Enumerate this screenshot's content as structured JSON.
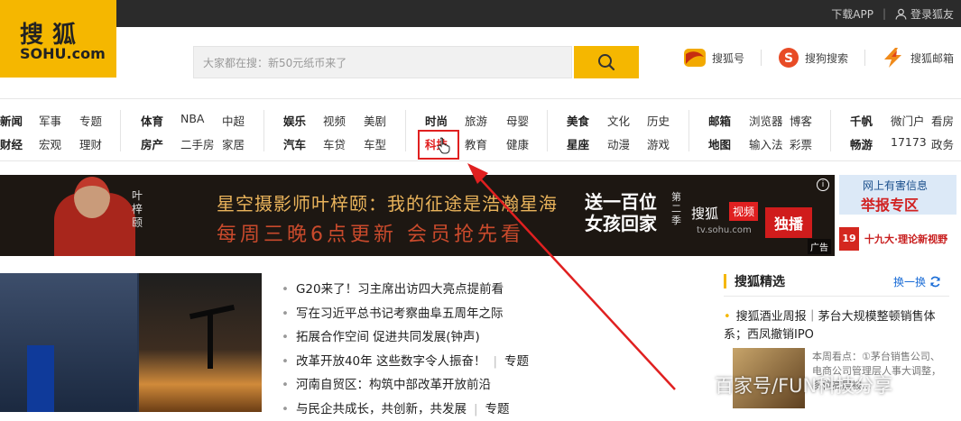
{
  "topbar": {
    "download": "下载APP",
    "separator": "|",
    "login": "登录狐友"
  },
  "logo": {
    "cn": "搜狐",
    "en": "SOHU.com"
  },
  "search": {
    "placeholder": "大家都在搜：新50元纸币来了"
  },
  "brands": [
    {
      "label": "搜狐号",
      "color": "#e23b18"
    },
    {
      "label": "搜狗搜索",
      "color": "#e84b26"
    },
    {
      "label": "搜狐邮箱",
      "color": "#f08a1a"
    }
  ],
  "nav": {
    "g1": [
      "新闻",
      "军事",
      "专题",
      "财经",
      "宏观",
      "理财"
    ],
    "g2": [
      "体育",
      "NBA",
      "中超",
      "房产",
      "二手房",
      "家居"
    ],
    "g3": [
      "娱乐",
      "视频",
      "美剧",
      "汽车",
      "车贷",
      "车型"
    ],
    "g4": [
      "时尚",
      "旅游",
      "母婴",
      "科技",
      "教育",
      "健康"
    ],
    "g5": [
      "美食",
      "文化",
      "历史",
      "星座",
      "动漫",
      "游戏"
    ],
    "g6": [
      "邮箱",
      "浏览器",
      "博客",
      "地图",
      "输入法",
      "彩票"
    ],
    "g7": [
      "千帆",
      "微门户",
      "看房",
      "畅游",
      "17173",
      "政务"
    ]
  },
  "banner": {
    "line1": "星空摄影师叶梓颐：我的征途是浩瀚星海",
    "line2": "每周三晚6点更新 会员抢先看",
    "name": "叶梓颐",
    "show": "送一百位女孩回家",
    "season": "第二季",
    "sv_logo": "搜狐",
    "sv_box": "视频",
    "url": "tv.sohu.com",
    "exclusive": "独播",
    "ad": "广告"
  },
  "side_ads": {
    "report_line1": "网上有害信息",
    "report_line2": "举报专区",
    "nineteen_badge": "19",
    "nineteen_text": "十九大·理论新视野"
  },
  "news": [
    {
      "text": "G20来了！习主席出访四大亮点提前看"
    },
    {
      "text": "写在习近平总书记考察曲阜五周年之际"
    },
    {
      "text": "拓展合作空间 促进共同发展(钟声)"
    },
    {
      "text": "改革开放40年 这些数字令人振奋！",
      "tag": "专题"
    },
    {
      "text": "河南自贸区：构筑中部改革开放前沿"
    },
    {
      "text": "与民企共成长，共创新，共发展",
      "tag": "专题"
    }
  ],
  "picks": {
    "title": "搜狐精选",
    "refresh": "换一换",
    "headline": "搜狐酒业周报｜茅台大规模整顿销售体系；西凤撤销IPO",
    "desc": "本周看点：①茅台销售公司、电商公司管理层人事大调整，多位高层被..."
  },
  "watermark": "百家号/FUN科技分享",
  "colors": {
    "accent": "#f5b700",
    "highlight": "#e02020",
    "link": "#1a6cd6"
  }
}
